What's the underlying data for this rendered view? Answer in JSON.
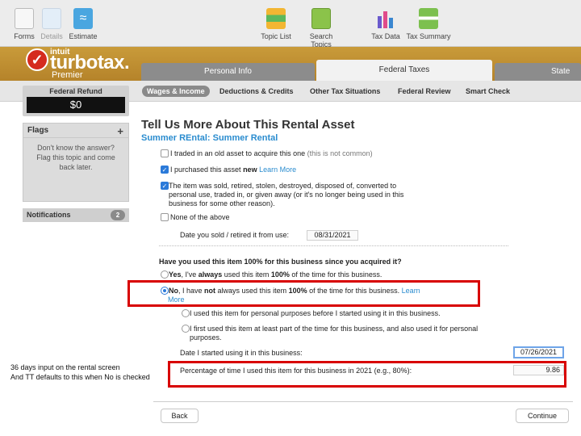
{
  "toolbar": {
    "items": [
      {
        "label": "Forms",
        "icon": "forms-icon"
      },
      {
        "label": "Details",
        "icon": "details-icon"
      },
      {
        "label": "Estimate",
        "icon": "estimate-icon"
      },
      {
        "label": "Topic List",
        "icon": "topic-list-icon"
      },
      {
        "label": "Search Topics",
        "icon": "search-topics-icon"
      },
      {
        "label": "Tax Data",
        "icon": "tax-data-icon"
      },
      {
        "label": "Tax Summary",
        "icon": "tax-summary-icon"
      }
    ]
  },
  "brand": {
    "intuit": "intuit",
    "name": "turbotax.",
    "tier": "Premier",
    "check": "✓"
  },
  "tabs": [
    "Personal Info",
    "Federal Taxes",
    "State"
  ],
  "subnav": [
    "Wages & Income",
    "Deductions & Credits",
    "Other Tax Situations",
    "Federal Review",
    "Smart Check"
  ],
  "sidebar": {
    "refund_label": "Federal Refund",
    "refund_amount": "$0",
    "flags_title": "Flags",
    "flags_plus": "+",
    "flags_text": "Don't know the answer? Flag this topic and come back later.",
    "notifications_label": "Notifications",
    "notifications_count": "2"
  },
  "main": {
    "title": "Tell Us More About This Rental Asset",
    "subtitle": "Summer REntal: Summer Rental",
    "options": {
      "traded": {
        "text": "I traded in an old asset to acquire this one",
        "note": "(this is not common)",
        "checked": false
      },
      "purchased": {
        "text_a": "I purchased this asset ",
        "text_bold": "new",
        "link": "Learn More",
        "checked": true
      },
      "sold": {
        "line1": "The item was sold, retired, stolen, destroyed, disposed of, converted to",
        "line2": "personal use, traded in, or given away (or it's no longer being used in this",
        "line3": "business for some other reason).",
        "checked": true
      },
      "none": {
        "text": "None of the above",
        "checked": false
      }
    },
    "date_sold_label": "Date you sold / retired it from use:",
    "date_sold_value": "08/31/2021",
    "question": "Have you used this item 100% for this business since you acquired it?",
    "yes": {
      "a": "Yes",
      "b": ", I've ",
      "c": "always",
      "d": " used this item ",
      "e": "100%",
      "f": " of the time for this business."
    },
    "no": {
      "a": "No",
      "b": ", I have ",
      "c": "not",
      "d": " always used this item ",
      "e": "100%",
      "f": " of the time for this business. ",
      "link1": "Learn",
      "link2": "More"
    },
    "sub1": "I used this item for personal purposes before I started using it in this business.",
    "sub2_line1": "I first used this item at least part of the time for this business, and also used it for personal",
    "sub2_line2": "purposes.",
    "date_started_label": "Date I started using it in this business:",
    "date_started_value": "07/26/2021",
    "percentage_label": "Percentage of time I used this item for this business in 2021 (e.g., 80%):",
    "percentage_value": "9.86"
  },
  "annotation": {
    "line1": "36 days input  on the rental screen",
    "line2": "And TT defaults to this when No is checked"
  },
  "buttons": {
    "back": "Back",
    "continue": "Continue"
  },
  "colors": {
    "brand_gold": "#b5832a",
    "link_blue": "#2a8ccf",
    "highlight_red": "#d80000",
    "check_blue": "#2b7ad9"
  }
}
